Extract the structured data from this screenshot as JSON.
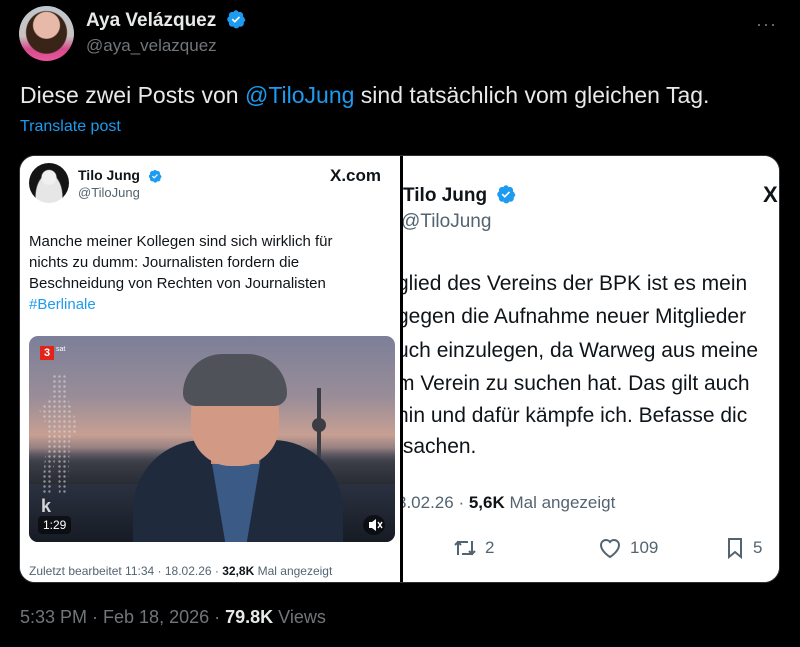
{
  "tweet": {
    "author_name": "Aya Velázquez",
    "author_handle": "@aya_velazquez",
    "text_prefix": "Diese zwei Posts von ",
    "mention": "@TiloJung",
    "text_suffix": " sind tatsächlich vom gleichen Tag.",
    "translate_label": "Translate post",
    "timestamp": "5:33 PM · Feb 18, 2026 · ",
    "views_count": "79.8K",
    "views_label": " Views",
    "more_icon": "···"
  },
  "left_card": {
    "name": "Tilo Jung",
    "handle": "@TiloJung",
    "source": "X.com",
    "text": "Manche meiner Kollegen sind sich wirklich für nichts zu dumm: Journalisten fordern die Beschneidung von Rechten von Journalisten",
    "hashtag": "#Berlinale",
    "video": {
      "channel_logo": "3",
      "channel_sub": "sat",
      "watermark": "k",
      "duration": "1:29"
    },
    "footer_prefix": "Zuletzt bearbeitet 11:34 · 18.02.26 · ",
    "footer_views": "32,8K",
    "footer_suffix": " Mal angezeigt"
  },
  "right_card": {
    "name": "Tilo Jung",
    "handle": "@TiloJung",
    "x_logo": "X",
    "lines": [
      "glied des Vereins der BPK ist es mein",
      "gegen die Aufnahme neuer Mitglieder",
      "uch einzulegen, da Warweg aus meine",
      "m Verein zu suchen hat. Das gilt auch",
      "hin und dafür kämpfe ich. Befasse dic",
      "tsachen."
    ],
    "meta_date": "3.02.26 · ",
    "meta_views": "5,6K",
    "meta_suffix": " Mal angezeigt",
    "reposts": "2",
    "likes": "109",
    "bookmarks": "5"
  },
  "colors": {
    "accent": "#1d9bf0",
    "background": "#000000",
    "muted": "#71767b"
  }
}
